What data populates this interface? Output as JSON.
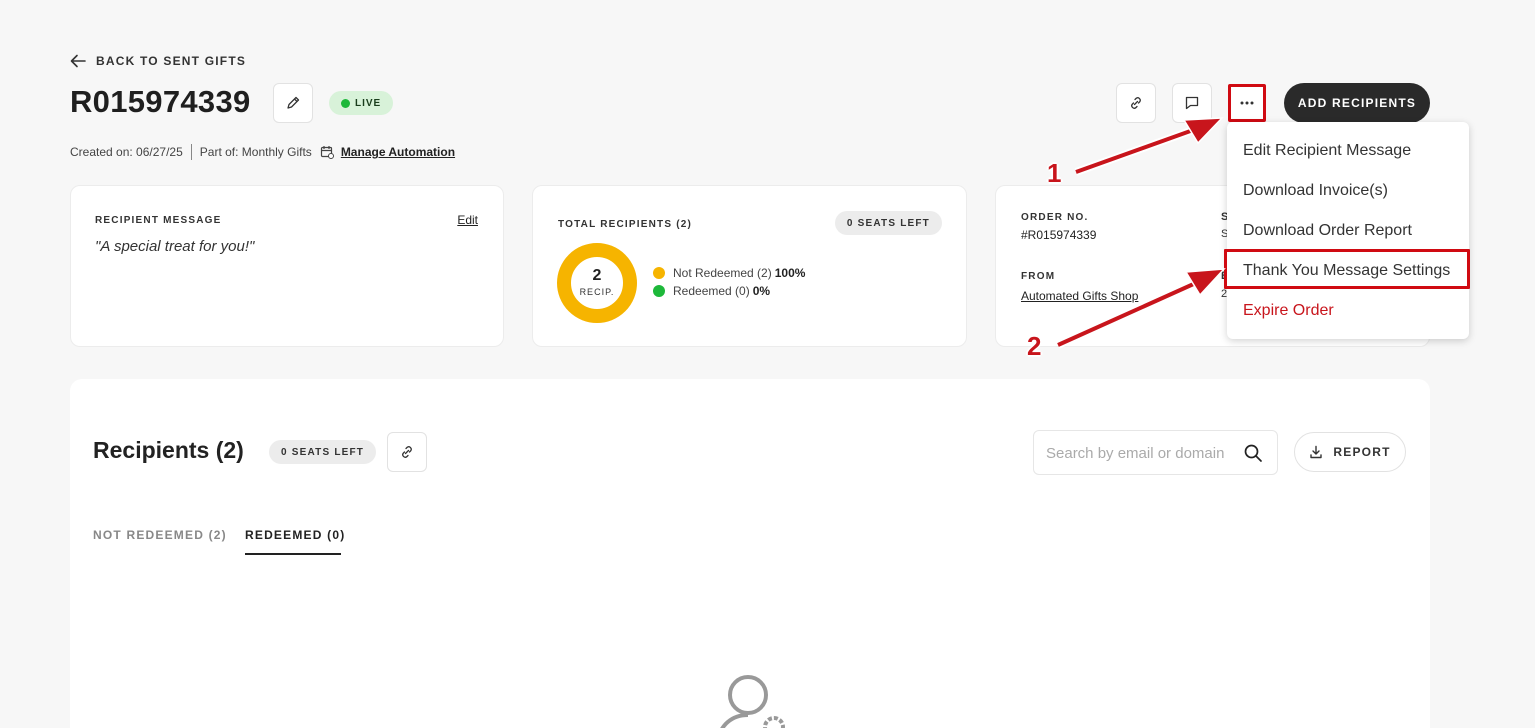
{
  "header": {
    "back_label": "BACK TO SENT GIFTS",
    "order_id": "R015974339",
    "status": "LIVE",
    "created_on": "Created on: 06/27/25",
    "part_of": "Part of: Monthly Gifts",
    "manage_automation": "Manage Automation",
    "add_recipients": "ADD RECIPIENTS"
  },
  "cards": {
    "message": {
      "label": "RECIPIENT MESSAGE",
      "edit": "Edit",
      "text": "\"A special treat for you!\""
    },
    "recipients": {
      "label": "TOTAL RECIPIENTS (2)",
      "seats": "0 SEATS LEFT",
      "count": "2",
      "unit": "RECIP.",
      "legend": [
        {
          "label": "Not Redeemed (2)",
          "pct": "100%",
          "color": "#f6b400"
        },
        {
          "label": "Redeemed (0)",
          "pct": "0%",
          "color": "#1db83a"
        }
      ]
    },
    "order": {
      "order_label": "ORDER NO.",
      "order_value": "#R015974339",
      "from_label": "FROM",
      "from_value": "Automated Gifts Shop",
      "col2_frag1": "S",
      "col2_frag2": "S",
      "col2_frag3": "E",
      "col2_frag4": "2"
    }
  },
  "menu": {
    "items": [
      {
        "label": "Edit Recipient Message"
      },
      {
        "label": "Download Invoice(s)"
      },
      {
        "label": "Download Order Report"
      },
      {
        "label": "Thank You Message Settings"
      },
      {
        "label": "Expire Order"
      }
    ]
  },
  "recipients_section": {
    "title": "Recipients (2)",
    "seats": "0 SEATS LEFT",
    "search_placeholder": "Search by email or domain",
    "report": "REPORT",
    "tabs": [
      {
        "label": "NOT REDEEMED (2)"
      },
      {
        "label": "REDEEMED (0)"
      }
    ]
  },
  "annotations": {
    "one": "1",
    "two": "2"
  },
  "colors": {
    "accent_red": "#d00a12",
    "live_green": "#1db83a",
    "donut_yellow": "#f6b400",
    "dark_button": "#2a2a2a"
  }
}
